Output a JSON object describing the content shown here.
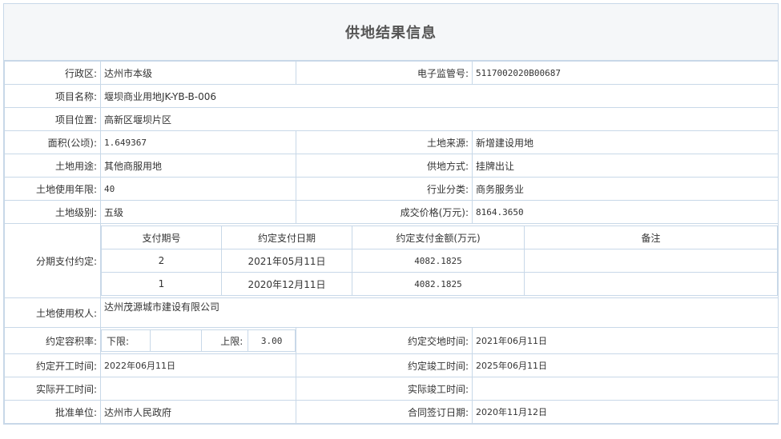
{
  "title": "供地结果信息",
  "fields": {
    "admin_region": {
      "label": "行政区:",
      "value": "达州市本级"
    },
    "supervision_no": {
      "label": "电子监管号:",
      "value": "5117002020B00687"
    },
    "project_name": {
      "label": "项目名称:",
      "value": "堰坝商业用地JK-YB-B-006"
    },
    "project_location": {
      "label": "项目位置:",
      "value": "高新区堰坝片区"
    },
    "area": {
      "label": "面积(公顷):",
      "value": "1.649367"
    },
    "land_source": {
      "label": "土地来源:",
      "value": "新增建设用地"
    },
    "land_use": {
      "label": "土地用途:",
      "value": "其他商服用地"
    },
    "supply_method": {
      "label": "供地方式:",
      "value": "挂牌出让"
    },
    "use_years": {
      "label": "土地使用年限:",
      "value": "40"
    },
    "industry": {
      "label": "行业分类:",
      "value": "商务服务业"
    },
    "land_level": {
      "label": "土地级别:",
      "value": "五级"
    },
    "deal_price": {
      "label": "成交价格(万元):",
      "value": "8164.3650"
    },
    "installment_label": "分期支付约定:",
    "land_user": {
      "label": "土地使用权人:",
      "value": "达州茂源城市建设有限公司"
    },
    "far_label": "约定容积率:",
    "far_lower_label": "下限:",
    "far_lower_value": "",
    "far_upper_label": "上限:",
    "far_upper_value": "3.00",
    "delivery_time": {
      "label": "约定交地时间:",
      "value": "2021年06月11日"
    },
    "start_time": {
      "label": "约定开工时间:",
      "value": "2022年06月11日"
    },
    "completion_time": {
      "label": "约定竣工时间:",
      "value": "2025年06月11日"
    },
    "actual_start": {
      "label": "实际开工时间:",
      "value": ""
    },
    "actual_completion": {
      "label": "实际竣工时间:",
      "value": ""
    },
    "approval_unit": {
      "label": "批准单位:",
      "value": "达州市人民政府"
    },
    "contract_date": {
      "label": "合同签订日期:",
      "value": "2020年11月12日"
    }
  },
  "installments": {
    "headers": [
      "支付期号",
      "约定支付日期",
      "约定支付金额(万元)",
      "备注"
    ],
    "rows": [
      {
        "no": "2",
        "date": "2021年05月11日",
        "amount": "4082.1825",
        "note": ""
      },
      {
        "no": "1",
        "date": "2020年12月11日",
        "amount": "4082.1825",
        "note": ""
      }
    ]
  }
}
